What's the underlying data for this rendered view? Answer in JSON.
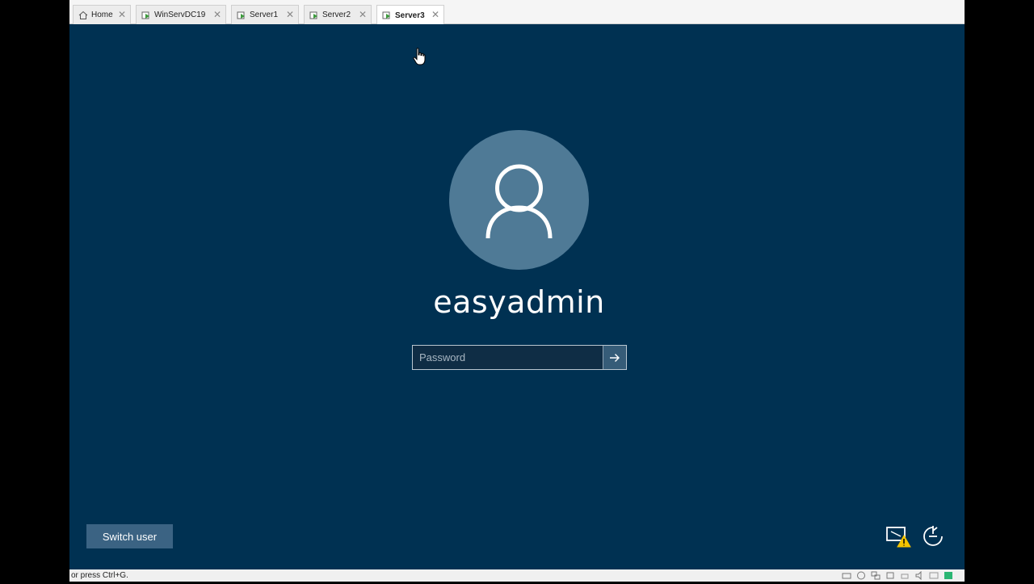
{
  "tabs": [
    {
      "label": "Home",
      "icon": "home-icon"
    },
    {
      "label": "WinServDC19",
      "icon": "vm-icon"
    },
    {
      "label": "Server1",
      "icon": "vm-icon"
    },
    {
      "label": "Server2",
      "icon": "vm-icon"
    },
    {
      "label": "Server3",
      "icon": "vm-icon",
      "active": true
    }
  ],
  "login": {
    "username": "easyadmin",
    "password_placeholder": "Password",
    "password_value": "",
    "switch_user_label": "Switch user"
  },
  "statusbar": {
    "hint": "or press Ctrl+G."
  },
  "colors": {
    "lock_background": "#003152",
    "avatar_circle": "#4f7a96",
    "switch_user_button": "#3b6383",
    "warning": "#f5c400"
  }
}
